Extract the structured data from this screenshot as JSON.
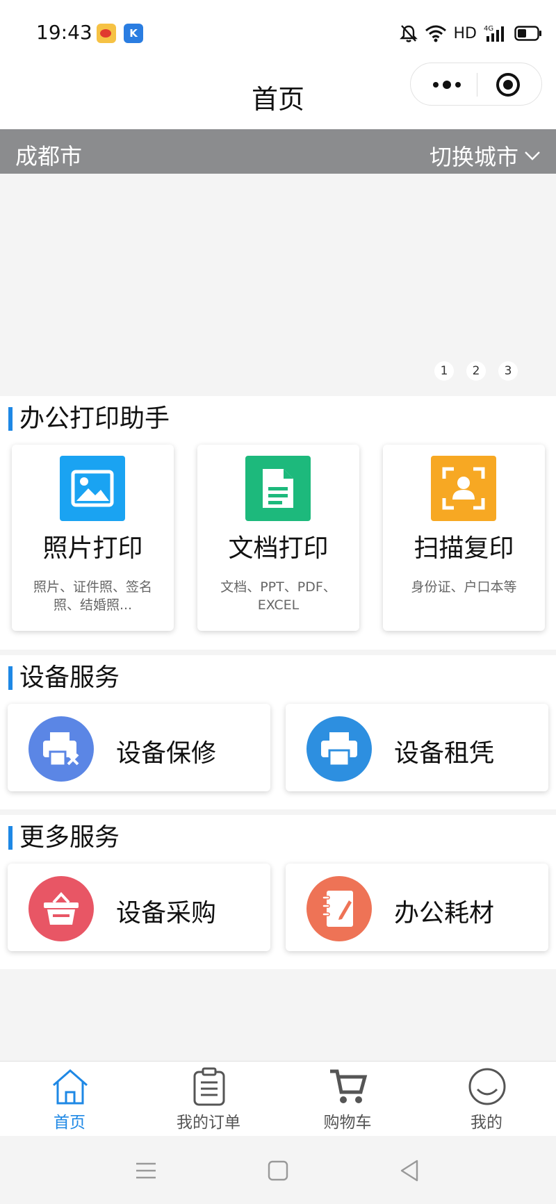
{
  "status_bar": {
    "time": "19:43",
    "network": "HD",
    "icons": [
      "weibo-icon",
      "k-app-icon",
      "mute-icon",
      "wifi-icon",
      "signal-4g-icon",
      "battery-icon"
    ]
  },
  "header": {
    "title": "首页",
    "capsule": [
      "more-icon",
      "close-target-icon"
    ]
  },
  "city_bar": {
    "city": "成都市",
    "switch_label": "切换城市"
  },
  "banner": {
    "indicators": [
      "1",
      "2",
      "3"
    ]
  },
  "print_section": {
    "title": "办公打印助手",
    "cards": [
      {
        "title": "照片打印",
        "desc": "照片、证件照、签名照、结婚照...",
        "icon": "photo-icon",
        "color": "#1aa3f2"
      },
      {
        "title": "文档打印",
        "desc": "文档、PPT、PDF、EXCEL",
        "icon": "document-icon",
        "color": "#1db97c"
      },
      {
        "title": "扫描复印",
        "desc": "身份证、户口本等",
        "icon": "scan-person-icon",
        "color": "#f7a823"
      }
    ]
  },
  "device_section": {
    "title": "设备服务",
    "items": [
      {
        "label": "设备保修",
        "icon": "printer-repair-icon",
        "color": "#5b86e5"
      },
      {
        "label": "设备租凭",
        "icon": "printer-icon",
        "color": "#2d8fe0"
      }
    ]
  },
  "more_section": {
    "title": "更多服务",
    "items": [
      {
        "label": "设备采购",
        "icon": "basket-icon",
        "color": "#e85665"
      },
      {
        "label": "办公耗材",
        "icon": "notebook-pen-icon",
        "color": "#ee7356"
      }
    ]
  },
  "tab_bar": {
    "tabs": [
      {
        "label": "首页",
        "icon": "home-icon",
        "active": true
      },
      {
        "label": "我的订单",
        "icon": "clipboard-icon",
        "active": false
      },
      {
        "label": "购物车",
        "icon": "cart-icon",
        "active": false
      },
      {
        "label": "我的",
        "icon": "smile-icon",
        "active": false
      }
    ]
  },
  "colors": {
    "accent": "#1e88e5",
    "city_bar": "#8b8c8e"
  }
}
